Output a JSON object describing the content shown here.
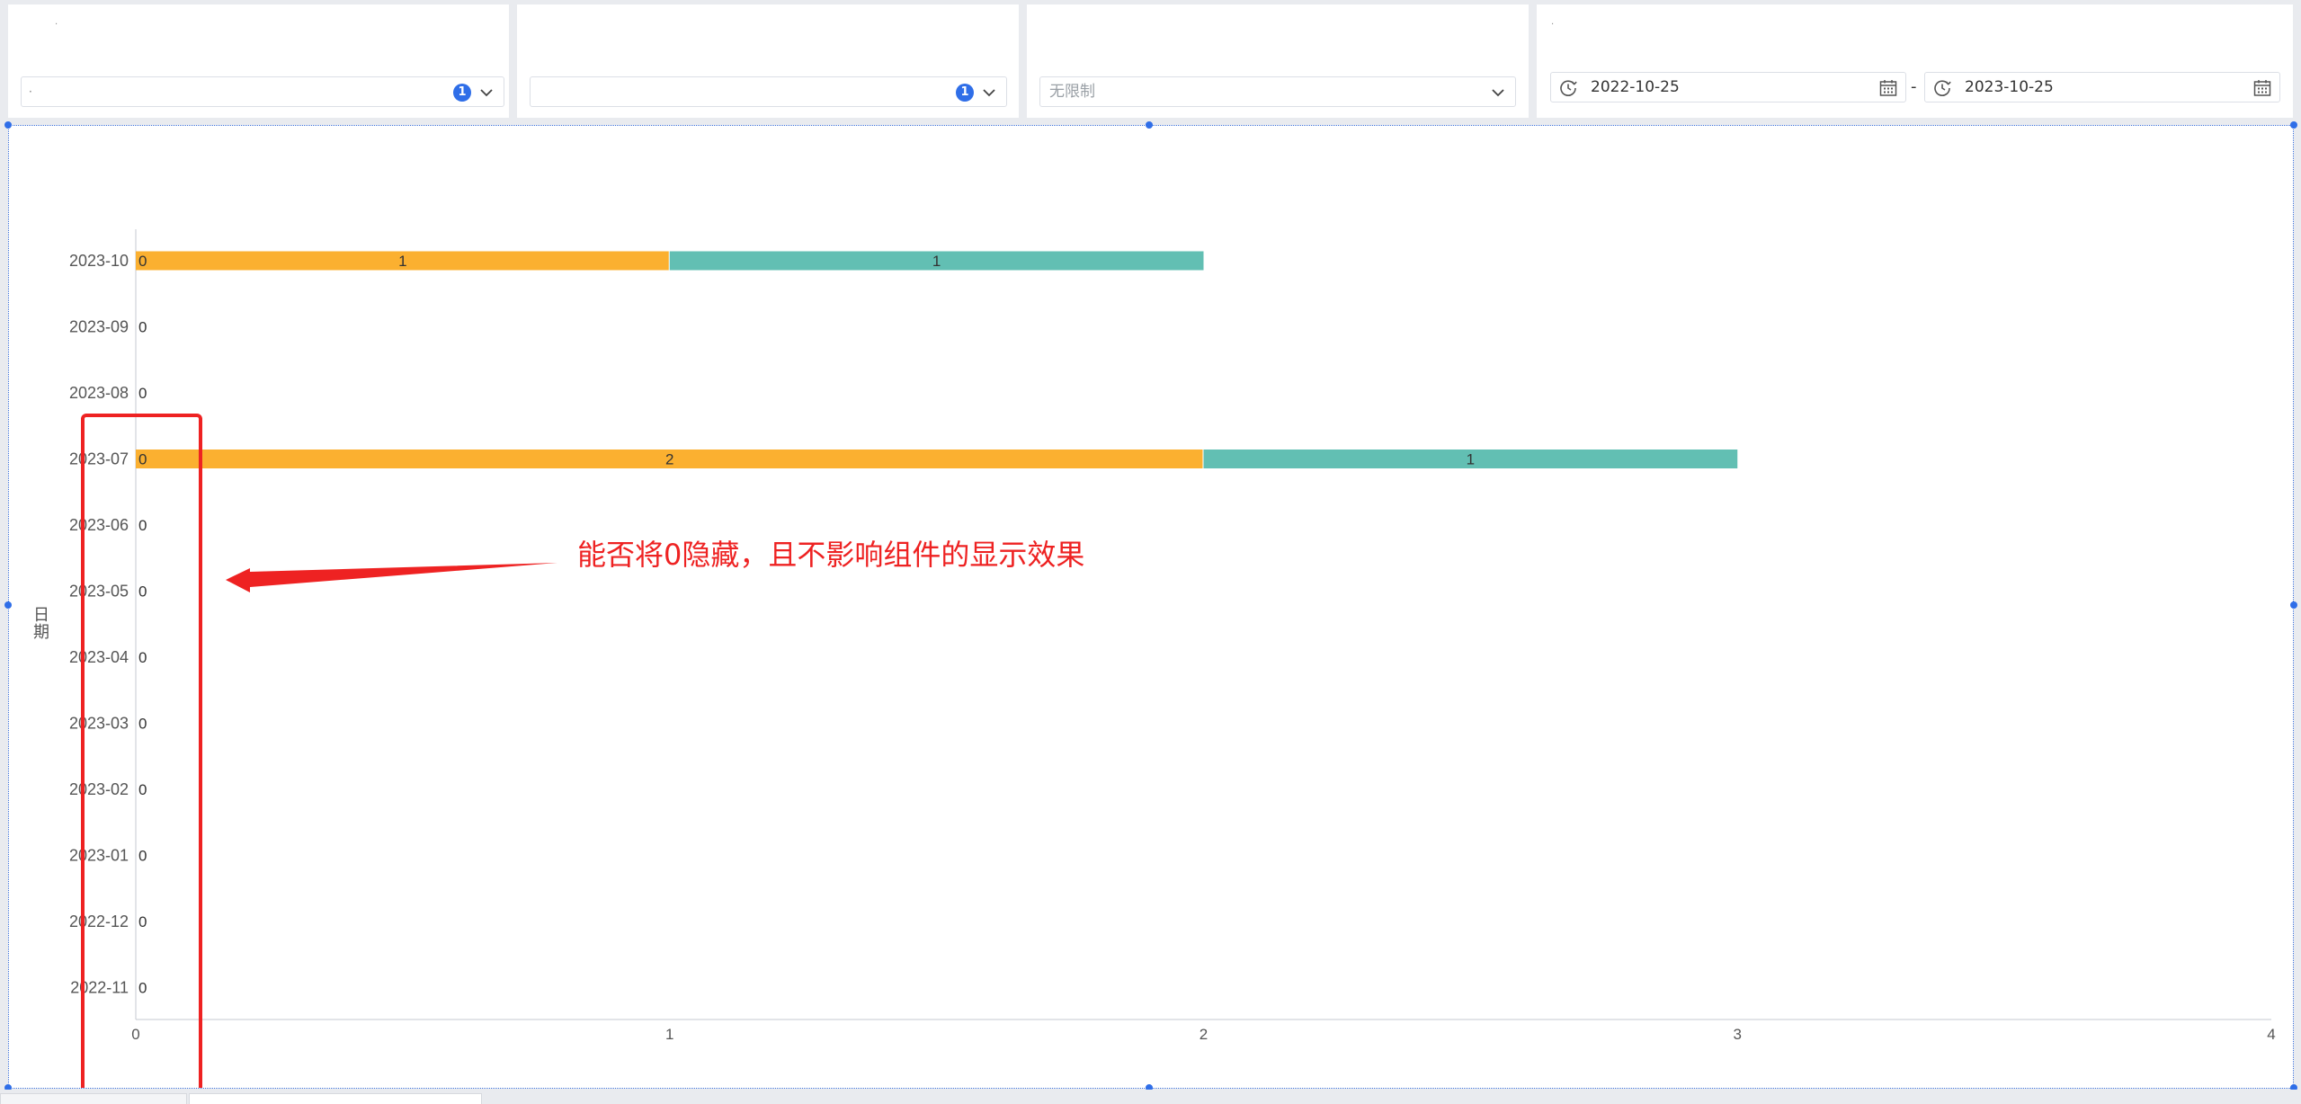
{
  "filters": [
    {
      "mark": "·",
      "value": "·",
      "count": "1"
    },
    {
      "value": "",
      "count": "1"
    },
    {
      "placeholder": "无限制"
    },
    {
      "mark": "·",
      "start_date": "2022-10-25",
      "separator": "-",
      "end_date": "2023-10-25"
    }
  ],
  "icons": {
    "dropdown": "chevron-down-icon",
    "clock": "clock-icon",
    "calendar": "calendar-icon"
  },
  "colors": {
    "series_a": "#fbb030",
    "series_b": "#62bfb3",
    "annotation": "#ee2222",
    "badge": "#2f6ee8"
  },
  "chart_data": {
    "type": "bar",
    "orientation": "horizontal",
    "stacked": true,
    "ylabel": "日期",
    "xlabel": "",
    "categories": [
      "2023-10",
      "2023-09",
      "2023-08",
      "2023-07",
      "2023-06",
      "2023-05",
      "2023-04",
      "2023-03",
      "2023-02",
      "2023-01",
      "2022-12",
      "2022-11"
    ],
    "series": [
      {
        "values": [
          0,
          0,
          0,
          0,
          0,
          0,
          0,
          0,
          0,
          0,
          0,
          0
        ],
        "color": "#fbb030"
      },
      {
        "values": [
          1,
          0,
          0,
          2,
          0,
          0,
          0,
          0,
          0,
          0,
          0,
          0
        ],
        "color": "#fbb030"
      },
      {
        "values": [
          1,
          0,
          0,
          1,
          0,
          0,
          0,
          0,
          0,
          0,
          0,
          0
        ],
        "color": "#62bfb3"
      }
    ],
    "xlim": [
      0,
      4
    ],
    "xticks": [
      "0",
      "1",
      "2",
      "3",
      "4"
    ],
    "grid": false,
    "legend": "none"
  },
  "annotation": {
    "text": "能否将0隐藏，且不影响组件的显示效果"
  }
}
